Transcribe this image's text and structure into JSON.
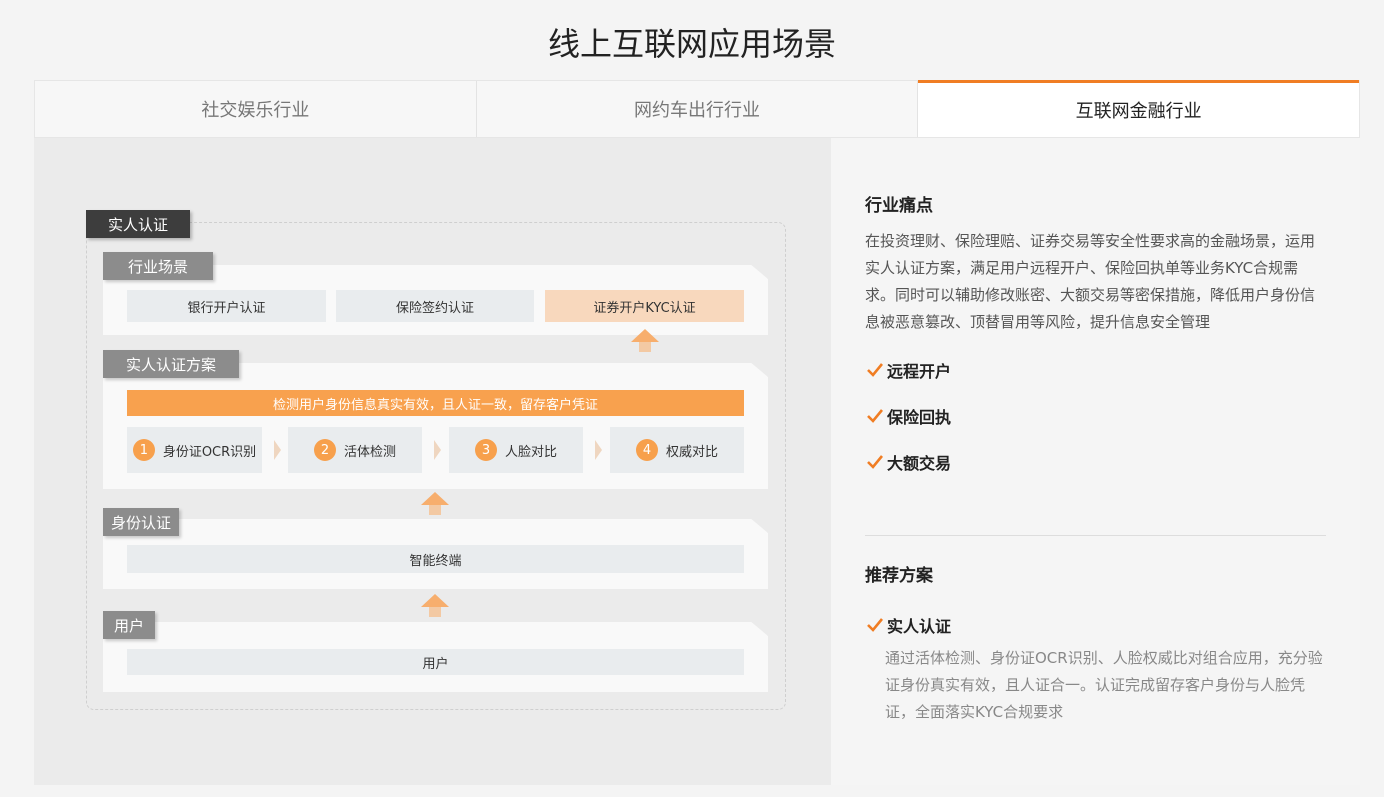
{
  "page": {
    "title": "线上互联网应用场景"
  },
  "tabs": [
    {
      "label": "社交娱乐行业",
      "active": false
    },
    {
      "label": "网约车出行行业",
      "active": false
    },
    {
      "label": "互联网金融行业",
      "active": true
    }
  ],
  "diagram": {
    "main_tag": "实人认证",
    "scene": {
      "tag": "行业场景",
      "items": [
        "银行开户认证",
        "保险签约认证",
        "证券开户KYC认证"
      ],
      "highlighted_index": 2
    },
    "solution": {
      "tag": "实人认证方案",
      "banner": "检测用户身份信息真实有效，且人证一致，留存客户凭证",
      "steps": [
        {
          "num": "1",
          "label": "身份证OCR识别"
        },
        {
          "num": "2",
          "label": "活体检测"
        },
        {
          "num": "3",
          "label": "人脸对比"
        },
        {
          "num": "4",
          "label": "权威对比"
        }
      ]
    },
    "identity": {
      "tag": "身份认证",
      "item": "智能终端"
    },
    "user": {
      "tag": "用户",
      "item": "用户"
    }
  },
  "info": {
    "pain_title": "行业痛点",
    "pain_text": "在投资理财、保险理赔、证券交易等安全性要求高的金融场景，运用实人认证方案，满足用户远程开户、保险回执单等业务KYC合规需求。同时可以辅助修改账密、大额交易等密保措施，降低用户身份信息被恶意篡改、顶替冒用等风险，提升信息安全管理",
    "checks": [
      "远程开户",
      "保险回执",
      "大额交易"
    ],
    "rec_title": "推荐方案",
    "solution_name": "实人认证",
    "solution_text": "通过活体检测、身份证OCR识别、人脸权威比对组合应用，充分验证身份真实有效，且人证合一。认证完成留存客户身份与人脸凭证，全面落实KYC合规要求"
  },
  "colors": {
    "accent": "#f07d23",
    "orange_bar": "#f8a14e",
    "dark_tag": "#3d3d3d",
    "grey_tag": "#8c8c8c",
    "highlight_cell": "#f8d8bd"
  },
  "icons": {
    "check": "checkmark-icon",
    "arrow": "up-arrow-icon",
    "step_sep": "chevron-right-icon"
  }
}
